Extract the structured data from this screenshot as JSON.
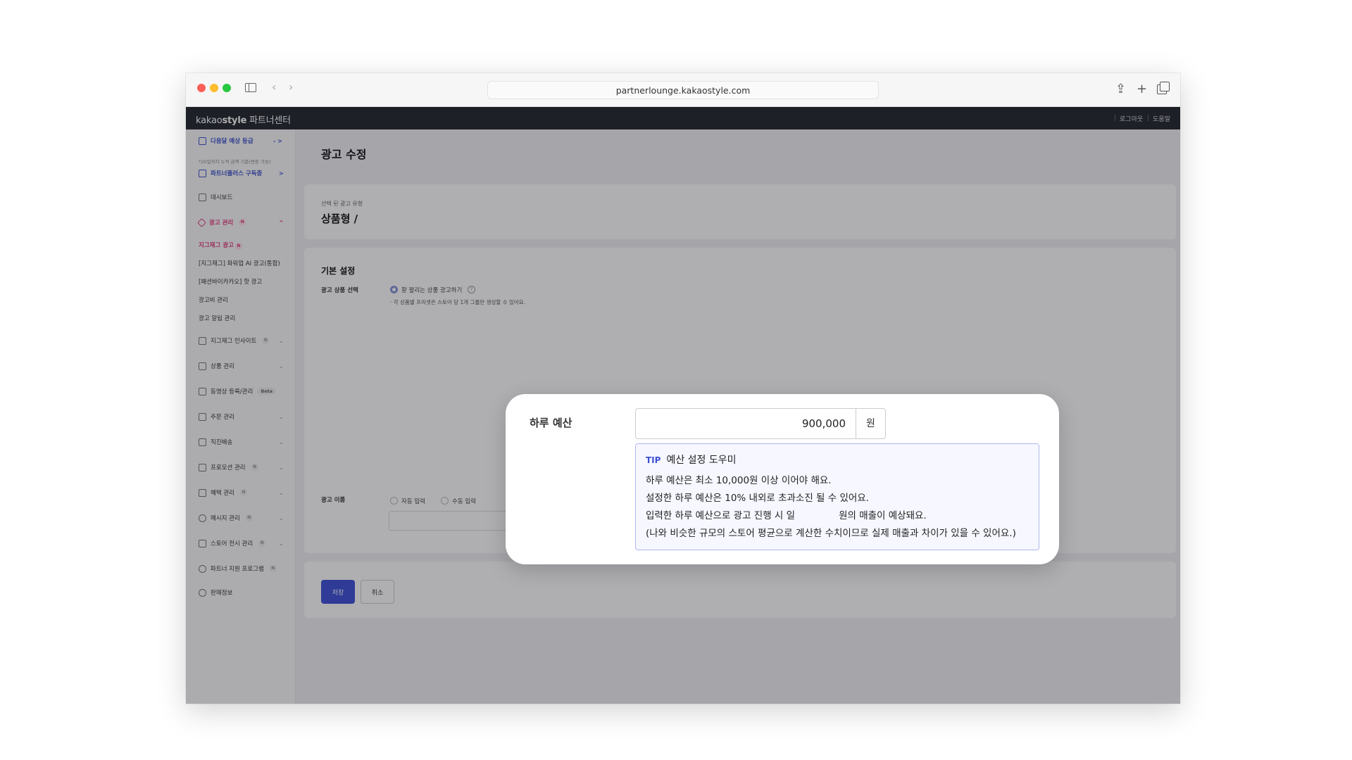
{
  "browser": {
    "url": "partnerlounge.kakaostyle.com",
    "back": "‹",
    "forward": "›",
    "share": "⇪",
    "new_tab": "+"
  },
  "header": {
    "brand_prefix": "kakao",
    "brand_strong": "style",
    "brand_suffix": "파트너센터",
    "logout": "로그아웃",
    "help": "도움말"
  },
  "sidebar": {
    "grade": {
      "label": "다음달 예상 등급",
      "note": "*20일까지 누적 금액 기준(변동 가능)",
      "chevron": "- >"
    },
    "subscription": {
      "label": "파트너플러스 구독중",
      "chevron": ">"
    },
    "dashboard": "대시보드",
    "ad_manage": {
      "label": "광고 관리",
      "badge": "N",
      "chevron": "^"
    },
    "ad_sub": [
      {
        "label": "지그재그 광고",
        "badge": "N"
      },
      {
        "label": "[지그재그] 파워업 AI 광고(통합)"
      },
      {
        "label": "[패션바이카카오] 핫 광고"
      },
      {
        "label": "광고비 관리"
      },
      {
        "label": "광고 알림 관리"
      }
    ],
    "menu": [
      {
        "label": "지그재그 인사이트",
        "badge": "N"
      },
      {
        "label": "상품 관리"
      },
      {
        "label": "동영상 등록/관리",
        "beta": "Beta"
      },
      {
        "label": "주문 관리"
      },
      {
        "label": "직진배송"
      },
      {
        "label": "프로모션 관리",
        "badge": "N"
      },
      {
        "label": "혜택 관리",
        "badge": "N"
      },
      {
        "label": "메시지 관리",
        "badge": "N"
      },
      {
        "label": "스토어 전시 관리",
        "badge": "N"
      },
      {
        "label": "파트너 지원 프로그램",
        "badge": "N"
      },
      {
        "label": "판매정보"
      }
    ],
    "chevron_down": "⌄"
  },
  "main": {
    "title": "광고 수정",
    "type_label": "선택 된 광고 유형",
    "type_value": "상품형 /",
    "basic_title": "기본 설정",
    "product_select_label": "광고 상품 선택",
    "product_select_option": "잘 팔리는 상품 광고하기",
    "product_hint": "· 각 상품별 프리셋은 스토어 당 1개 그룹만 생성할 수 있어요.",
    "info": "?",
    "ad_name_label": "광고 이름",
    "ad_name_auto": "자동 입력",
    "ad_name_manual": "수동 입력",
    "save": "저장",
    "cancel": "취소"
  },
  "budget_popup": {
    "label": "하루 예산",
    "value": "900,000",
    "unit": "원",
    "tip_tag": "TIP",
    "tip_title": "예산 설정 도우미",
    "lines": [
      "하루 예산은 최소 10,000원 이상 이어야 해요.",
      "설정한 하루 예산은 10% 내외로 초과소진 될 수 있어요."
    ],
    "line3_a": "입력한 하루 예산으로 광고 진행 시 일",
    "line3_b": "원의 매출이 예상돼요.",
    "line4": "(나와 비슷한 규모의 스토어 평균으로 계산한 수치이므로 실제 매출과 차이가 있을 수 있어요.)"
  },
  "colors": {
    "header_bg": "#24262d",
    "accent_blue": "#3d4fd6",
    "accent_pink": "#e23d7a",
    "tip_border": "#aeb6ee"
  }
}
